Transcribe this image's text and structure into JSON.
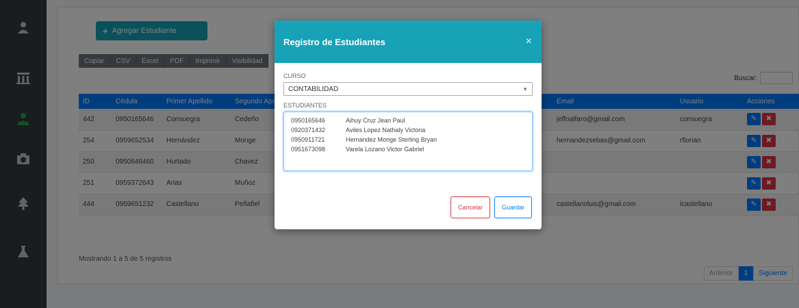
{
  "sidebar": {
    "icons": [
      "user-icon",
      "table-icon",
      "students-icon",
      "camera-icon",
      "tree-icon",
      "flask-icon"
    ]
  },
  "page": {
    "add_button_label": "Agregar Estudiante",
    "export_buttons": [
      "Copiar",
      "CSV",
      "Excel",
      "PDF",
      "Imprimir",
      "Visibilidad"
    ],
    "search_label": "Buscar:",
    "info_text": "Mostrando 1 a 5 de 5 registros",
    "pagination": {
      "previous": "Anterior",
      "current": "1",
      "next": "Siguiente"
    }
  },
  "table": {
    "columns": [
      "ID",
      "Cédula",
      "Primer Apellido",
      "Segundo Apellido",
      "Email",
      "Usuario",
      "Acciones"
    ],
    "rows": [
      {
        "id": "442",
        "cedula": "0950165646",
        "apellido": "Consuegra",
        "segundo": "Cedeño",
        "email": "jeffoalfaro@gmail.com",
        "usuario": "consuegra"
      },
      {
        "id": "254",
        "cedula": "0959652534",
        "apellido": "Hernández",
        "segundo": "Monge",
        "email": "hernandezsebas@gmail.com",
        "usuario": "rflorian"
      },
      {
        "id": "250",
        "cedula": "0950646460",
        "apellido": "Hurtado",
        "segundo": "Chavez",
        "email": "",
        "usuario": ""
      },
      {
        "id": "251",
        "cedula": "0959372643",
        "apellido": "Arias",
        "segundo": "Muñoz",
        "email": "",
        "usuario": ""
      },
      {
        "id": "444",
        "cedula": "0959651232",
        "apellido": "Castellano",
        "segundo": "Peñafiel",
        "email": "castellanoluis@gmail.com",
        "usuario": "lcastellano"
      }
    ]
  },
  "modal": {
    "title": "Registro de Estudiantes",
    "close_glyph": "×",
    "curso_label": "CURSO",
    "curso_value": "CONTABILIDAD",
    "estudiantes_label": "ESTUDIANTES",
    "estudiantes": [
      {
        "cedula": "0950165646",
        "nombre": "Aihuy Cruz Jean Paul"
      },
      {
        "cedula": "0920371432",
        "nombre": "Aviles Lopez Nathaly Victoria"
      },
      {
        "cedula": "0950911721",
        "nombre": "Hernandez Monge Sterling Bryan"
      },
      {
        "cedula": "0951673098",
        "nombre": "Varela Lozano Victor Gabriel"
      }
    ],
    "cancel_label": "Cancelar",
    "save_label": "Guardar"
  }
}
